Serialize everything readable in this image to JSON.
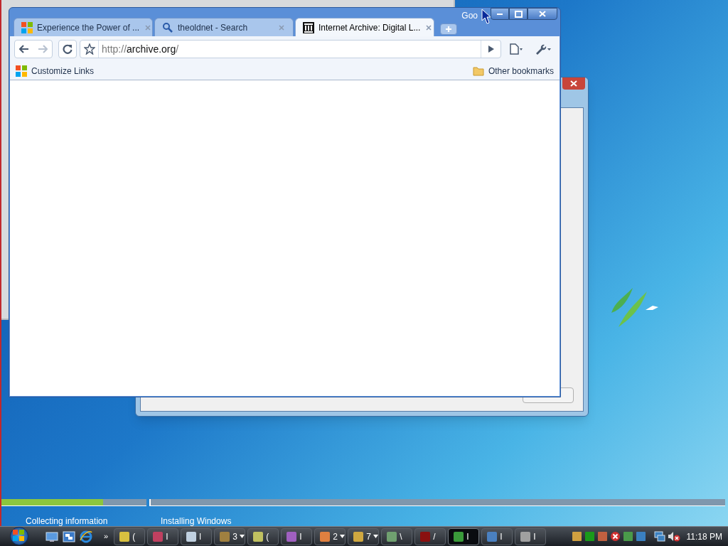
{
  "setup": {
    "progress": [
      {
        "level": 0.7
      },
      {
        "level": 0
      }
    ],
    "steps": [
      {
        "label": "Collecting information"
      },
      {
        "label": "Installing Windows"
      }
    ]
  },
  "browser": {
    "title_text": "Goo",
    "tabs": [
      {
        "title": "Experience the Power of ...",
        "selected": false
      },
      {
        "title": "theoldnet - Search",
        "selected": false
      },
      {
        "title": "Internet Archive: Digital L...",
        "selected": true
      }
    ],
    "address": {
      "scheme": "http://",
      "host": "archive.org",
      "path": "/"
    },
    "forward_disabled": true,
    "bookmarks": [
      {
        "label": "Customize Links",
        "kind": "link"
      },
      {
        "label": "Other bookmarks",
        "kind": "folder"
      }
    ]
  },
  "taskbar": {
    "buttons": [
      {
        "label": "(",
        "grouped": false,
        "active": false
      },
      {
        "label": "I",
        "grouped": false,
        "active": false
      },
      {
        "label": "l",
        "grouped": false,
        "active": false
      },
      {
        "label": "3",
        "grouped": true,
        "active": false
      },
      {
        "label": "(",
        "grouped": false,
        "active": false
      },
      {
        "label": "I",
        "grouped": false,
        "active": false
      },
      {
        "label": "2",
        "grouped": true,
        "active": false
      },
      {
        "label": "7",
        "grouped": true,
        "active": false
      },
      {
        "label": "\\",
        "grouped": false,
        "active": false
      },
      {
        "label": "/",
        "grouped": false,
        "active": false
      },
      {
        "label": "I",
        "grouped": false,
        "active": true
      },
      {
        "label": "I",
        "grouped": false,
        "active": false
      },
      {
        "label": "I",
        "grouped": false,
        "active": false
      }
    ],
    "overflow": "»",
    "clock": "11:18 PM"
  }
}
